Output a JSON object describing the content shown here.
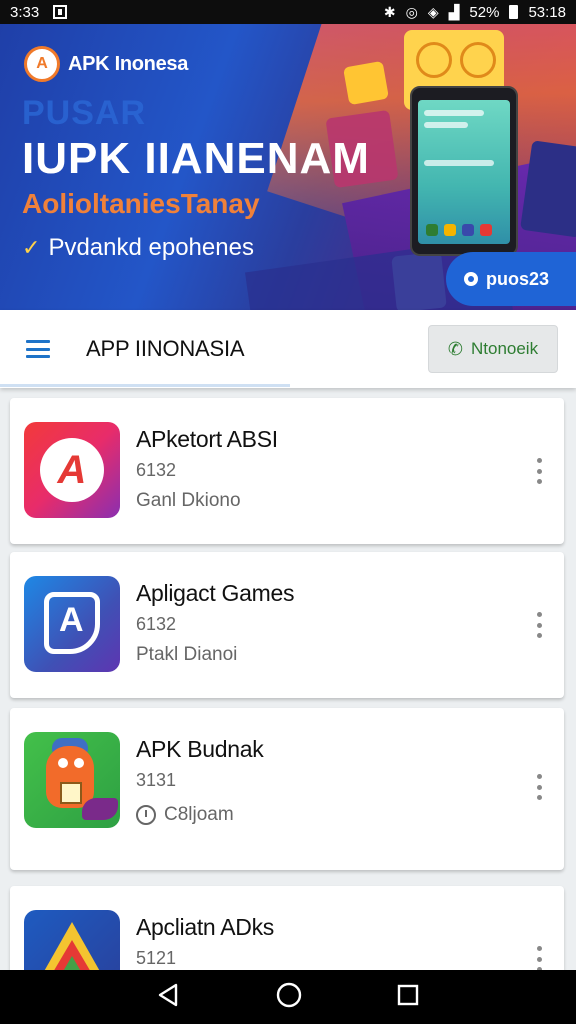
{
  "status_bar": {
    "time": "3:33",
    "battery_percent": "52%",
    "clock_right": "53:18"
  },
  "banner": {
    "brand": "APK Inonesa",
    "pre_title": "PUSAR",
    "title": "IUPK IIANENAM",
    "subtitle": "AolioltaniesTanay",
    "check_line": "Pvdankd epohenes",
    "pill_label": "puos23",
    "colors": {
      "accent_orange": "#f0813a",
      "pill_blue": "#1f64d6"
    }
  },
  "appbar": {
    "title": "APP IINONASIA",
    "action_label": "Ntonoeik"
  },
  "apps": [
    {
      "name": "APketort ABSI",
      "meta": "6132",
      "sub": "Ganl Dkiono",
      "icon": "red-a-logo-icon",
      "sub_icon": false
    },
    {
      "name": "Apligact Games",
      "meta": "6132",
      "sub": "Ptakl Dianoi",
      "icon": "blue-a-logo-icon",
      "sub_icon": false
    },
    {
      "name": "APK Budnak",
      "meta": "3131",
      "sub": "C8ljoam",
      "icon": "orange-mascot-icon",
      "sub_icon": true
    },
    {
      "name": "Apcliatn ADks",
      "meta": "5121",
      "sub": "",
      "icon": "triangle-logo-icon",
      "sub_icon": false
    }
  ],
  "navbar": {
    "icons": [
      "back-icon",
      "home-icon",
      "recents-icon"
    ]
  }
}
